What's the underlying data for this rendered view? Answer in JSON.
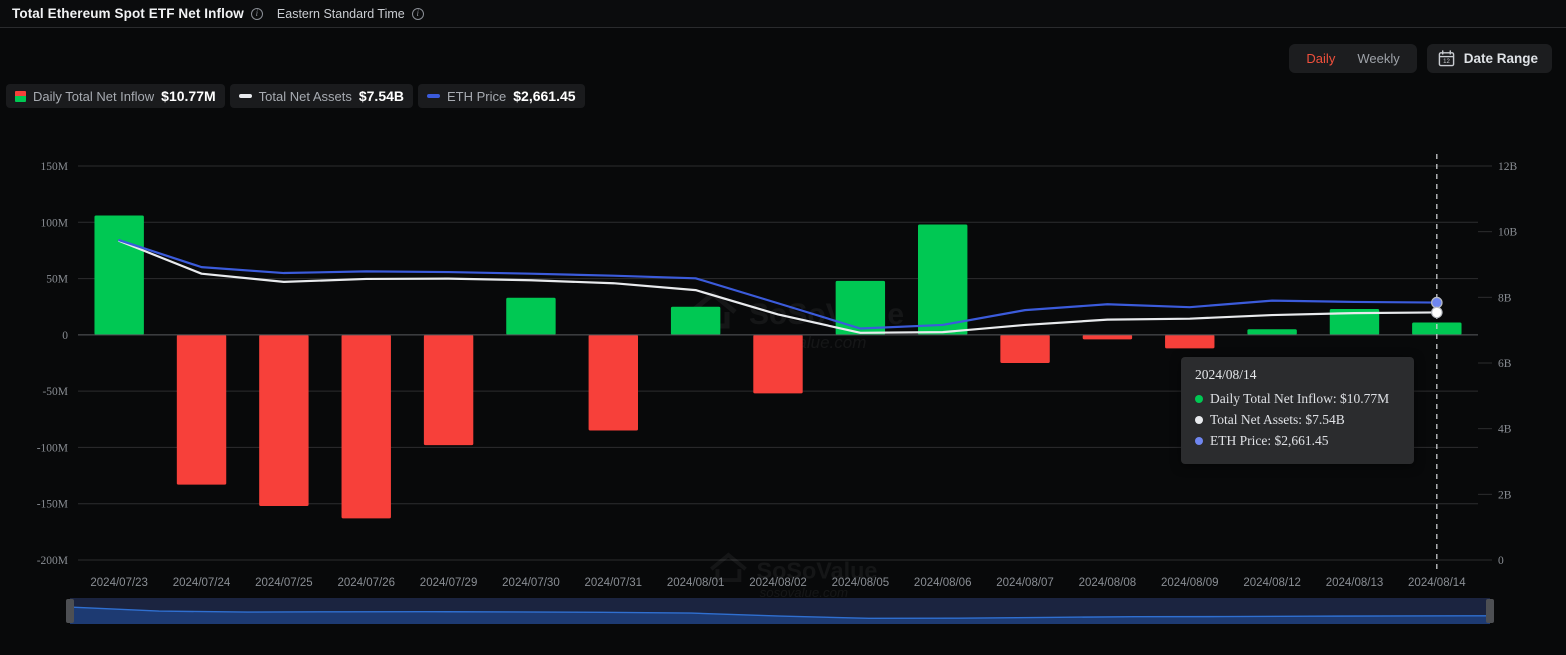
{
  "header": {
    "title": "Total Ethereum Spot ETF Net Inflow",
    "title_info_icon": "info-icon",
    "timezone": "Eastern Standard Time",
    "tz_info_icon": "info-icon"
  },
  "toolbar": {
    "daily_label": "Daily",
    "weekly_label": "Weekly",
    "active_interval": "Daily",
    "date_range_label": "Date Range",
    "calendar_icon": "calendar-icon",
    "calendar_icon_day": "12",
    "active_color": "#f0503c"
  },
  "legend": [
    {
      "label": "Daily Total Net Inflow",
      "value": "$10.77M",
      "marker": "split-square",
      "color_up": "#00c853",
      "color_down": "#f7403a"
    },
    {
      "label": "Total Net Assets",
      "value": "$7.54B",
      "marker": "dash",
      "color": "#e8eaed"
    },
    {
      "label": "ETH Price",
      "value": "$2,661.45",
      "marker": "dash",
      "color": "#3b5bdb"
    }
  ],
  "tooltip": {
    "date": "2024/08/14",
    "rows": [
      {
        "label": "Daily Total Net Inflow",
        "value": "$10.77M",
        "color": "#00c853"
      },
      {
        "label": "Total Net Assets",
        "value": "$7.54B",
        "color": "#e8eaed"
      },
      {
        "label": "ETH Price",
        "value": "$2,661.45",
        "color": "#6f86f0"
      }
    ]
  },
  "watermark": {
    "brand": "SoSoValue",
    "site": "sosovalue.com"
  },
  "brush": {
    "left_handle": "brush-left-handle",
    "right_handle": "brush-right-handle"
  },
  "chart_data": {
    "type": "bar",
    "title": "Total Ethereum Spot ETF Net Inflow",
    "xlabel": "",
    "ylabel": "Daily Total Net Inflow",
    "y2label": "Total Net Assets / ETH Price",
    "grid": true,
    "legend_position": "top-left",
    "categories": [
      "2024/07/23",
      "2024/07/24",
      "2024/07/25",
      "2024/07/26",
      "2024/07/29",
      "2024/07/30",
      "2024/07/31",
      "2024/08/01",
      "2024/08/02",
      "2024/08/05",
      "2024/08/06",
      "2024/08/07",
      "2024/08/08",
      "2024/08/09",
      "2024/08/12",
      "2024/08/13",
      "2024/08/14"
    ],
    "ylim": [
      -200,
      150
    ],
    "yticks": [
      "150M",
      "100M",
      "50M",
      "0",
      "-50M",
      "-100M",
      "-150M",
      "-200M"
    ],
    "ytick_values": [
      150,
      100,
      50,
      0,
      -50,
      -100,
      -150,
      -200
    ],
    "y2lim": [
      0,
      12
    ],
    "y2ticks": [
      "12B",
      "10B",
      "8B",
      "6B",
      "4B",
      "2B",
      "0"
    ],
    "y2tick_values": [
      12,
      10,
      8,
      6,
      4,
      2,
      0
    ],
    "series": [
      {
        "name": "Daily Total Net Inflow",
        "type": "bar",
        "unit": "M",
        "axis": "left",
        "color_positive": "#00c853",
        "color_negative": "#f7403a",
        "values": [
          106,
          -133,
          -152,
          -163,
          -98,
          33,
          -85,
          25,
          -52,
          48,
          98,
          -25,
          -4,
          -12,
          5,
          23,
          11
        ]
      },
      {
        "name": "Total Net Assets",
        "type": "line",
        "unit": "B",
        "axis": "right",
        "color": "#e8eaed",
        "values": [
          9.72,
          8.72,
          8.47,
          8.56,
          8.57,
          8.52,
          8.43,
          8.22,
          7.48,
          6.92,
          6.94,
          7.16,
          7.32,
          7.35,
          7.46,
          7.52,
          7.54
        ]
      },
      {
        "name": "ETH Price",
        "type": "line",
        "unit": "USD",
        "axis": "right",
        "display_axis_note": "scaled on right axis",
        "color": "#3b5bdb",
        "values": [
          9.74,
          8.92,
          8.74,
          8.79,
          8.77,
          8.72,
          8.66,
          8.58,
          7.82,
          7.05,
          7.16,
          7.61,
          7.79,
          7.7,
          7.9,
          7.86,
          7.84
        ]
      }
    ],
    "highlight": {
      "category": "2024/08/14",
      "crosshair": true
    }
  }
}
